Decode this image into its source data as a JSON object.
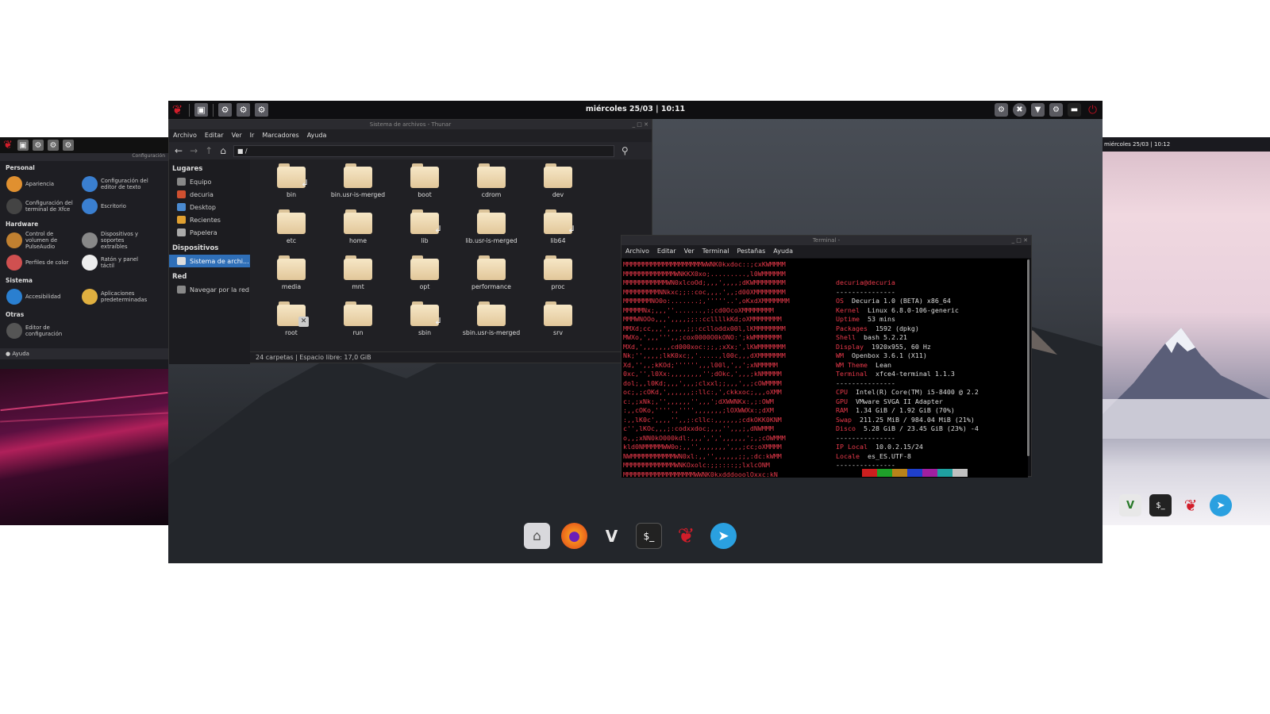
{
  "left_window": {
    "window_title": "Configuración",
    "sections": [
      {
        "title": "Personal",
        "items": [
          [
            "Apariencia",
            "Configuración del editor de texto"
          ],
          [
            "Configuración del terminal de Xfce",
            "Escritorio"
          ]
        ]
      },
      {
        "title": "Hardware",
        "items": [
          [
            "Control de volumen de PulseAudio",
            "Dispositivos y soportes extraíbles"
          ],
          [
            "Perfiles de color",
            "Ratón y panel táctil"
          ]
        ]
      },
      {
        "title": "Sistema",
        "items": [
          [
            "Accesibilidad",
            "Aplicaciones predeterminadas"
          ]
        ]
      },
      {
        "title": "Otras",
        "items": [
          [
            "Editor de configuración",
            ""
          ]
        ]
      }
    ],
    "help_button": "Ayuda"
  },
  "right_window": {
    "clock": "miércoles 25/03 | 10:12"
  },
  "panel": {
    "clock": "miércoles 25/03 | 10:11"
  },
  "thunar": {
    "title": "Sistema de archivos - Thunar",
    "menu": [
      "Archivo",
      "Editar",
      "Ver",
      "Ir",
      "Marcadores",
      "Ayuda"
    ],
    "path": "/",
    "sidebar": {
      "places_title": "Lugares",
      "places": [
        "Equipo",
        "decuria",
        "Desktop",
        "Recientes",
        "Papelera"
      ],
      "devices_title": "Dispositivos",
      "devices": [
        "Sistema de archi..."
      ],
      "network_title": "Red",
      "network": [
        "Navegar por la red"
      ]
    },
    "folders": [
      {
        "name": "bin",
        "link": true
      },
      {
        "name": "bin.usr-is-merged"
      },
      {
        "name": "boot"
      },
      {
        "name": "cdrom"
      },
      {
        "name": "dev"
      },
      {
        "name": "etc"
      },
      {
        "name": "home"
      },
      {
        "name": "lib",
        "link": true
      },
      {
        "name": "lib.usr-is-merged"
      },
      {
        "name": "lib64",
        "link": true
      },
      {
        "name": "media"
      },
      {
        "name": "mnt"
      },
      {
        "name": "opt"
      },
      {
        "name": "performance"
      },
      {
        "name": "proc"
      },
      {
        "name": "root",
        "locked": true
      },
      {
        "name": "run"
      },
      {
        "name": "sbin",
        "link": true
      },
      {
        "name": "sbin.usr-is-merged"
      },
      {
        "name": "srv"
      }
    ],
    "status": "24 carpetas  |  Espacio libre: 17,0 GiB"
  },
  "terminal": {
    "title": "Terminal -",
    "menu": [
      "Archivo",
      "Editar",
      "Ver",
      "Terminal",
      "Pestañas",
      "Ayuda"
    ],
    "ascii_art": "MMMMMMMMMMMMMMMMMMMMWWNK0kxdoc::;cxKWMMMM\nMMMMMMMMMMMMMWNKKX0xo;.........,l0WMMMMMM\nMMMMMMMMMMMWN0xlcoOd;,,,',,,,;dKWMMMMMMMM\nMMMMMMMMMNNkxc;;::coc,,,.',,;d00XMMMMMMMM\nMMMMMMMNO0o:.......;,'''''..',oKxdXMMMMMMM\nMMMMMNx;,,,''.......,:;cd0OcoXMMMMMMMM\nMMMWNOOo,,,',,,,;;::ccllllkKd;oXMMMMMMMM\nMMXd;cc,,,',,,,,;;:cclloddx00l,lKMMMMMMMM\nMWXo,',,,''',,;cox0000O0kONO:';kWMMMMMMM\nMXd,',,,,,,,cd000xoc:;;,;xXx;',lKWMMMMMMM\nNk;'',,,,;lkK0xc;,'.....,l00c,,,dXMMMMMMM\nXd,'',,;kKOd;'''''',,,l00l,',,';xNMMMMM\n0xc,'',l0Xx:,,,,,,,,'';dOkc,',,,;kNMMMMM\ndol;,,l0Kd;,,,',,,;clxxl;;,,,',,;cOWMMMM\noc;,;cOKd,',,,,,,;:llc:,',ckkxoc;,,,oXMM\nc:,;xNk;,'',,,,,,'',,,';dXWWNKx:,;:OWM\n:,,cOKo,''''.,'''',,,,,,,;lOXWWXx:;dXM\n:,,lK0c',,,,'',,;:cllc:,,,,,,;cdkOKK0KNM\nc'',lKOc,,,;:codxxdoc;,,,'',,,;,dNWMMM\no,,;xNN0kO000kdl:,,,',',',,,,,,';,;cOWMMM\nkld0NMMMMMWW0o;,,'',,,,,,,',,,;cc;oXMMMM\nNWMMMMMMMMMMMWN0xl:,,'',,,,,,;;,:dc:kWMM\nMMMMMMMMMMMMMWNKOxolc:;;::::;;lxlcONM\nMMMMMMMMMMMMMMMMMMWWNK0kxdddooolOxxc:kN",
    "user": "decuria@decuria",
    "separator": "---------------",
    "info": [
      {
        "key": "OS",
        "value": "Decuria 1.0 (BETA) x86_64"
      },
      {
        "key": "Kernel",
        "value": "Linux 6.8.0-106-generic"
      },
      {
        "key": "Uptime",
        "value": "53 mins"
      },
      {
        "key": "Packages",
        "value": "1592 (dpkg)"
      },
      {
        "key": "Shell",
        "value": "bash 5.2.21"
      },
      {
        "key": "Display",
        "value": "1920x955, 60 Hz"
      },
      {
        "key": "WM",
        "value": "Openbox 3.6.1 (X11)"
      },
      {
        "key": "WM Theme",
        "value": "Lean"
      },
      {
        "key": "Terminal",
        "value": "xfce4-terminal 1.1.3"
      }
    ],
    "info2": [
      {
        "key": "CPU",
        "value": "Intel(R) Core(TM) i5-8400 @ 2.2"
      },
      {
        "key": "GPU",
        "value": "VMware SVGA II Adapter"
      },
      {
        "key": "RAM",
        "value": "1.34 GiB / 1.92 GiB (70%)"
      },
      {
        "key": "Swap",
        "value": "211.25 MiB / 984.04 MiB (21%)"
      },
      {
        "key": "Disco",
        "value": "5.28 GiB / 23.45 GiB (23%) -4"
      }
    ],
    "info3": [
      {
        "key": "IP Local",
        "value": "10.0.2.15/24"
      },
      {
        "key": "Locale",
        "value": "es_ES.UTF-8"
      }
    ],
    "palette": [
      "#000000",
      "#cc1f1f",
      "#1fa02a",
      "#b8831a",
      "#1f3fcc",
      "#a01fa0",
      "#1fa0a0",
      "#c0c0c0"
    ]
  },
  "dock": {
    "apps": [
      "home-folder-icon",
      "firefox-icon",
      "vim-icon",
      "terminal-icon",
      "decuria-logo-icon",
      "browser-icon"
    ]
  },
  "colors": {
    "accent": "#2f6fb8",
    "brand_red": "#d21d2a",
    "term_red": "#e8394a"
  }
}
